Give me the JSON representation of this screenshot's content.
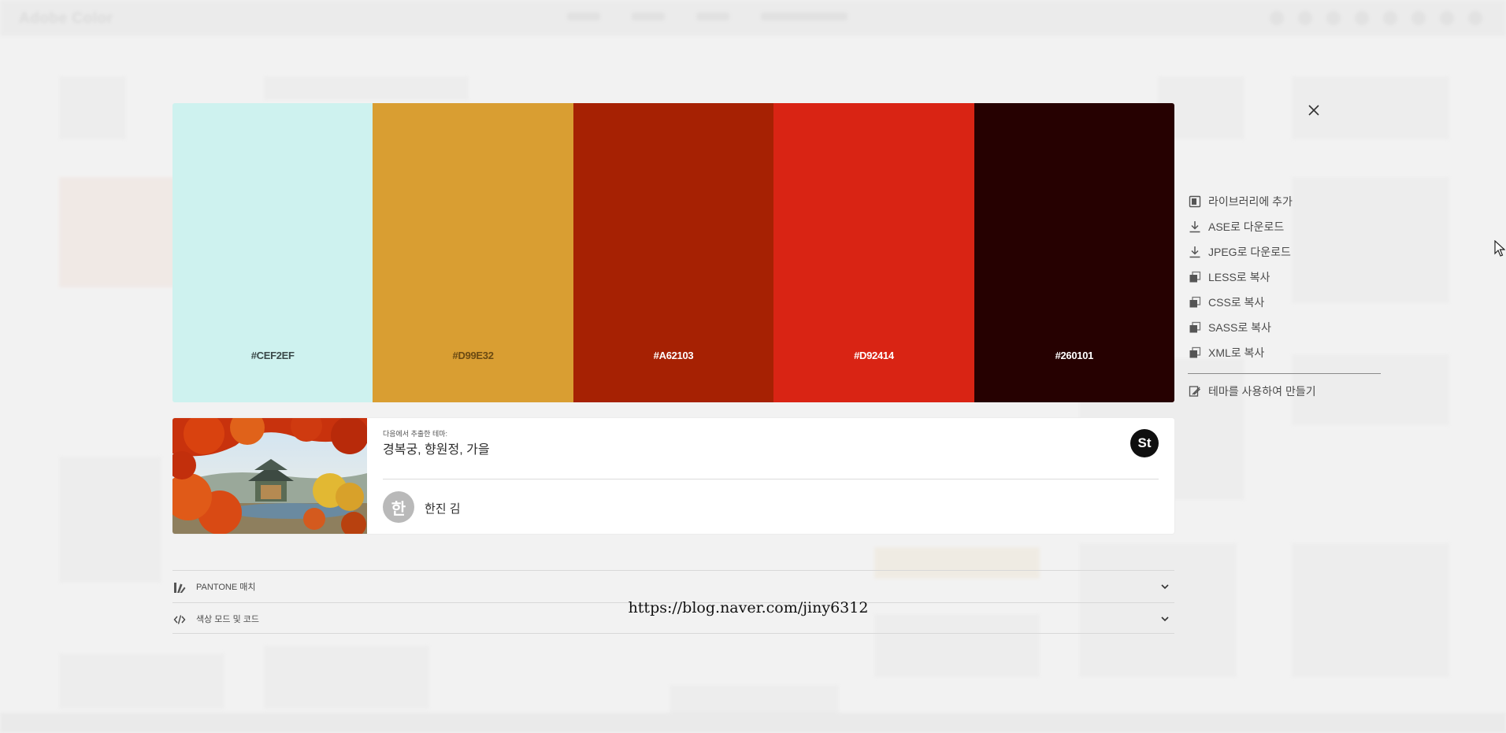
{
  "app": {
    "logo_text": "Adobe Color"
  },
  "palette": [
    {
      "hex": "#CEF2EF",
      "label": "#CEF2EF"
    },
    {
      "hex": "#D99E32",
      "label": "#D99E32"
    },
    {
      "hex": "#A62103",
      "label": "#A62103"
    },
    {
      "hex": "#D92414",
      "label": "#D92414"
    },
    {
      "hex": "#260101",
      "label": "#260101"
    }
  ],
  "actions": {
    "add_library": "라이브러리에 추가",
    "download_ase": "ASE로 다운로드",
    "download_jpeg": "JPEG로 다운로드",
    "copy_less": "LESS로 복사",
    "copy_css": "CSS로 복사",
    "copy_sass": "SASS로 복사",
    "copy_xml": "XML로 복사",
    "create_with_theme": "테마를 사용하여 만들기"
  },
  "theme": {
    "featured_label": "다음에서 추출한 테마:",
    "title": "경복궁, 향원정, 가을",
    "stock_badge": "St",
    "author_initial": "한",
    "author_name": "한진 김"
  },
  "accordions": {
    "pantone": "PANTONE 매치",
    "color_modes": "색상 모드 및 코드"
  },
  "watermark": "https://blog.naver.com/jiny6312",
  "icons": {
    "close": "close-icon",
    "library": "library-icon",
    "download": "download-icon",
    "copy": "copy-icon",
    "create": "create-icon",
    "pantone": "pantone-icon",
    "code": "code-icon",
    "chevron": "chevron-down-icon"
  }
}
